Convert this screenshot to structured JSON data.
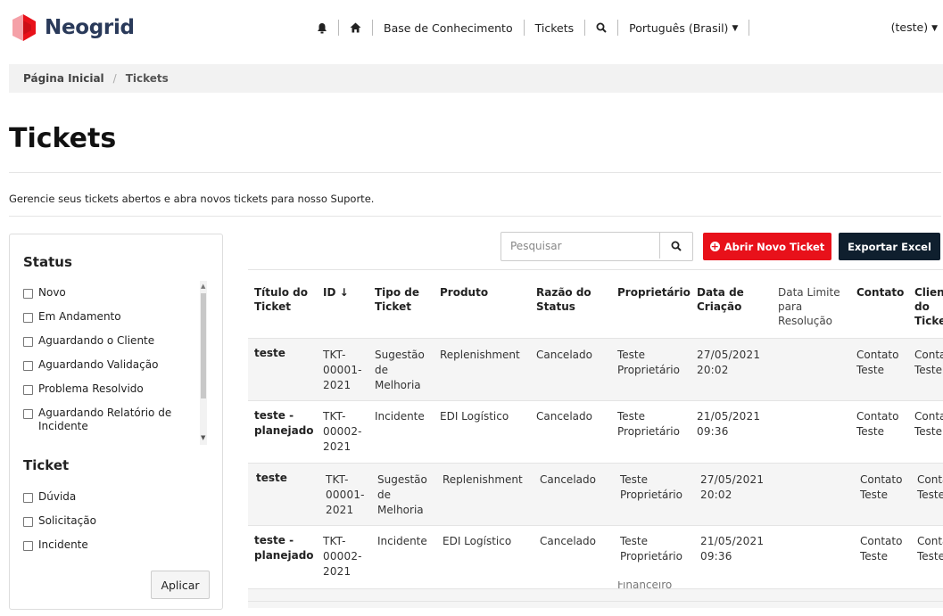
{
  "header": {
    "logo_text": "Neogrid",
    "nav": [
      "Base de Conhecimento",
      "Tickets"
    ],
    "language": "Português (Brasil)",
    "user": "(teste)"
  },
  "breadcrumb": {
    "home": "Página Inicial",
    "current": "Tickets",
    "separator": "/"
  },
  "page": {
    "title": "Tickets",
    "subtitle": "Gerencie seus tickets abertos e abra novos tickets para nosso Suporte."
  },
  "filters": {
    "status_title": "Status",
    "status_options": [
      "Novo",
      "Em Andamento",
      "Aguardando o Cliente",
      "Aguardando Validação",
      "Problema Resolvido",
      "Aguardando Relatório de Incidente"
    ],
    "ticket_title": "Ticket",
    "ticket_options": [
      "Dúvida",
      "Solicitação",
      "Incidente"
    ],
    "apply_label": "Aplicar"
  },
  "toolbar": {
    "search_placeholder": "Pesquisar",
    "new_ticket_label": "Abrir Novo Ticket",
    "export_label": "Exportar Excel"
  },
  "table": {
    "columns": [
      "Título do Ticket",
      "ID",
      "Tipo de Ticket",
      "Produto",
      "Razão do Status",
      "Proprietário",
      "Data de Criação",
      "Data Limite para Resolução",
      "Contato",
      "Cliente do Ticket"
    ],
    "sort_indicator": "↓",
    "rows": [
      {
        "title": "teste",
        "id": "TKT-00001-2021",
        "type": "Sugestão de Melhoria",
        "product": "Replenishment",
        "status_reason": "Cancelado",
        "owner": "Teste Proprietário",
        "created": "27/05/2021 20:02",
        "deadline": "",
        "contact": "Contato Teste",
        "client": "Contato Teste"
      },
      {
        "title": "teste - planejado",
        "id": "TKT-00002-2021",
        "type": "Incidente",
        "product": "EDI Logístico",
        "status_reason": "Cancelado",
        "owner": "Teste Proprietário",
        "created": "21/05/2021 09:36",
        "deadline": "",
        "contact": "Contato Teste",
        "client": "Contato Teste"
      },
      {
        "title": "teste",
        "id": "TKT-00001-2021",
        "type": "Sugestão de Melhoria",
        "product": "Replenishment",
        "status_reason": "Cancelado",
        "owner": "Teste Proprietário",
        "created": "27/05/2021 20:02",
        "deadline": "",
        "contact": "Contato Teste",
        "client": "Contato Teste"
      },
      {
        "title": "teste - planejado",
        "id": "TKT-00002-2021",
        "type": "Incidente",
        "product": "EDI Logístico",
        "status_reason": "Cancelado",
        "owner": "Teste Proprietário",
        "created": "21/05/2021 09:36",
        "deadline": "",
        "contact": "Contato Teste",
        "client": "Contato Teste"
      }
    ],
    "overflow_text": "Financeiro"
  },
  "colors": {
    "brand_red": "#e8111a",
    "dark": "#0f1f2e",
    "logo_text": "#2a3a5a"
  },
  "icons": {
    "notification": "bell-icon",
    "home": "home-icon",
    "search": "search-icon",
    "plus": "plus-circle-icon"
  }
}
